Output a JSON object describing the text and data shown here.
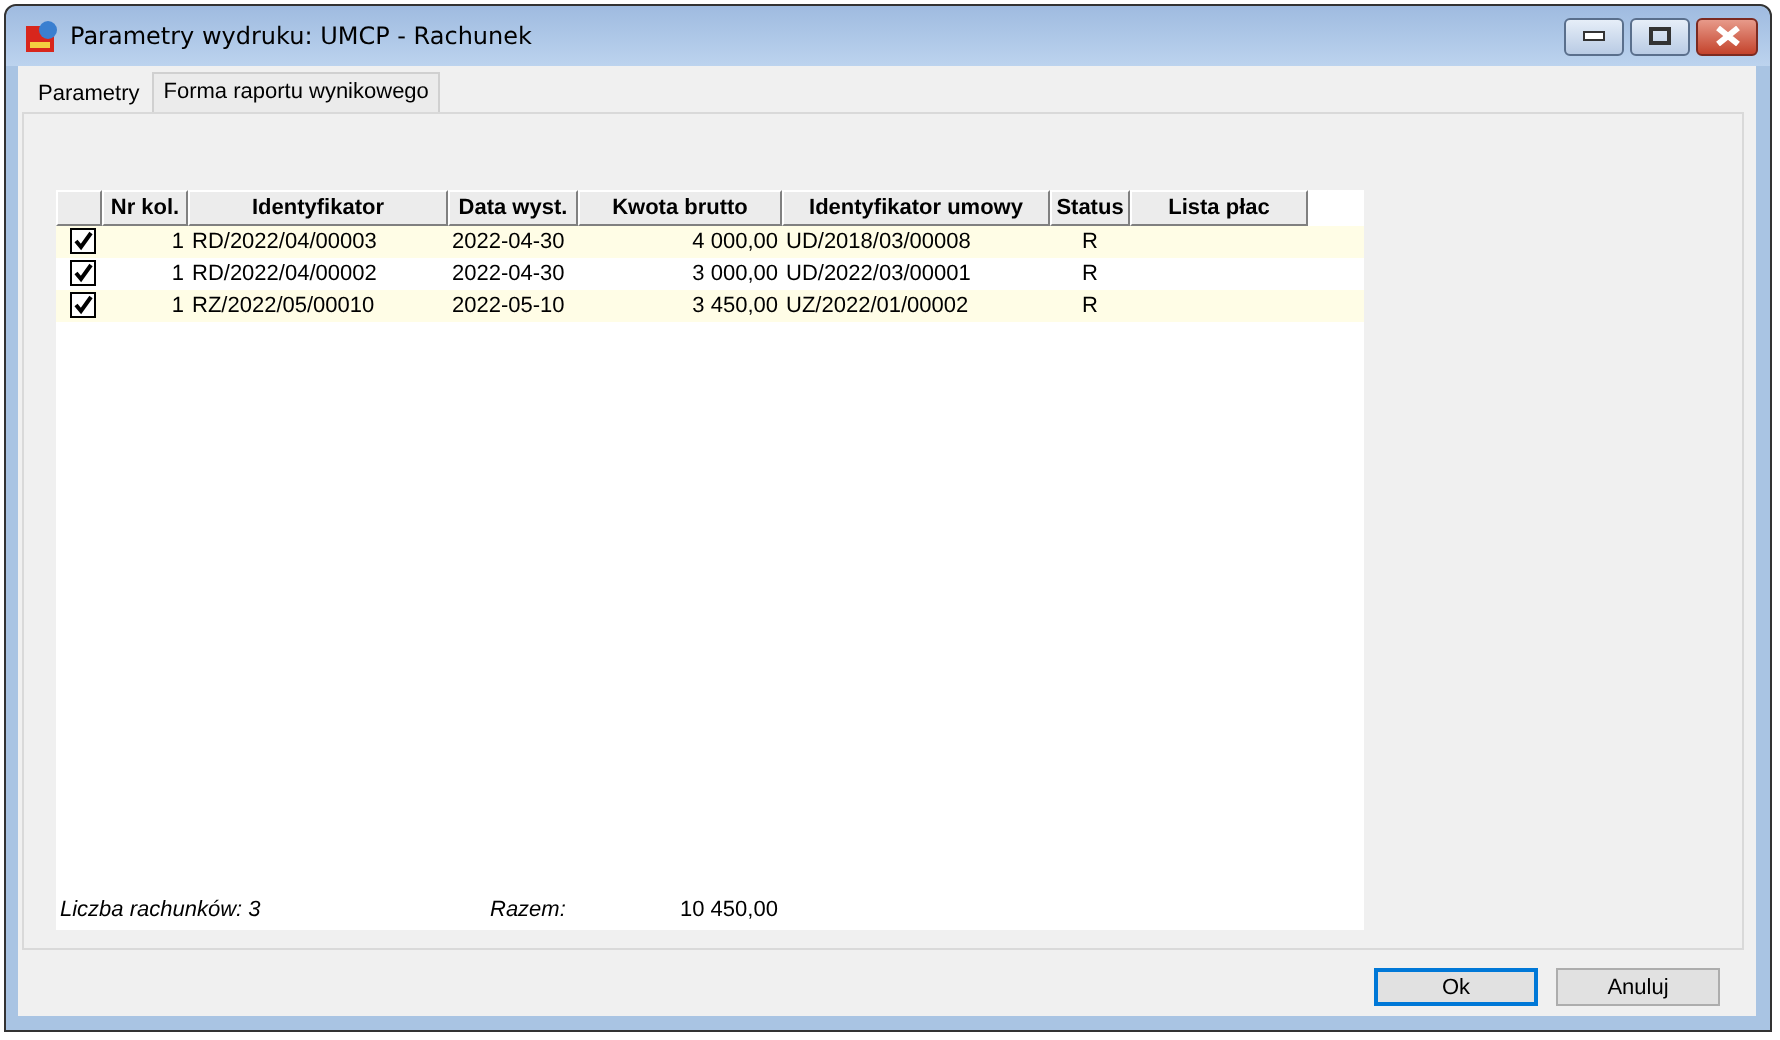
{
  "window": {
    "title": "Parametry wydruku: UMCP - Rachunek"
  },
  "tabs": [
    {
      "label": "Parametry",
      "selected": true
    },
    {
      "label": "Forma raportu wynikowego",
      "selected": false
    }
  ],
  "table": {
    "columns": [
      "",
      "Nr kol.",
      "Identyfikator",
      "Data wyst.",
      "Kwota brutto",
      "Identyfikator umowy",
      "Status",
      "Lista płac"
    ],
    "rows": [
      {
        "checked": true,
        "cells": [
          "",
          "1",
          "RD/2022/04/00003",
          "2022-04-30",
          "4 000,00",
          "UD/2018/03/00008",
          "R",
          ""
        ]
      },
      {
        "checked": true,
        "cells": [
          "",
          "1",
          "RD/2022/04/00002",
          "2022-04-30",
          "3 000,00",
          "UD/2022/03/00001",
          "R",
          ""
        ]
      },
      {
        "checked": true,
        "cells": [
          "",
          "1",
          "RZ/2022/05/00010",
          "2022-05-10",
          "3 450,00",
          "UZ/2022/01/00002",
          "R",
          ""
        ]
      }
    ]
  },
  "summary": {
    "count_label": "Liczba rachunków: 3",
    "total_label": "Razem:",
    "total_value": "10 450,00"
  },
  "buttons": [
    {
      "label": "Ok",
      "default": true
    },
    {
      "label": "Anuluj",
      "default": false
    }
  ]
}
